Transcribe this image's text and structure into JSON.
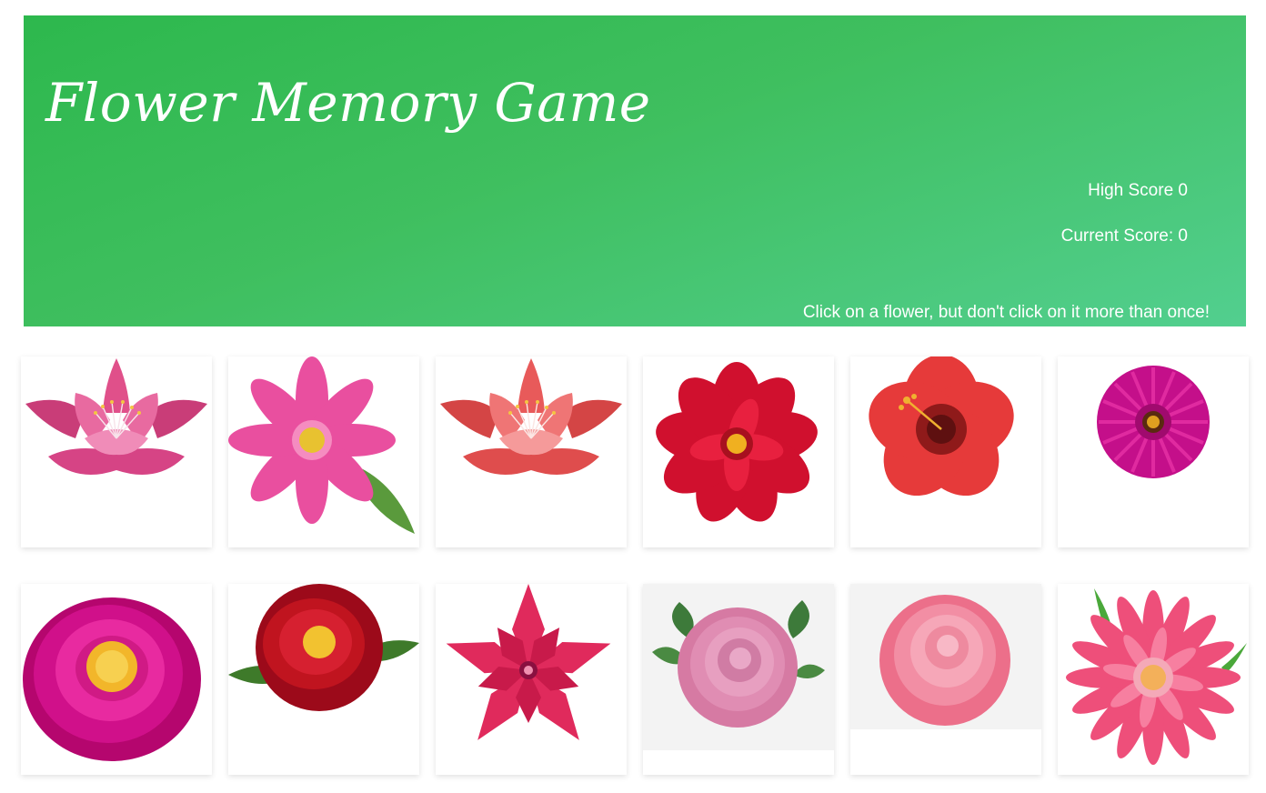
{
  "header": {
    "title": "Flower Memory Game",
    "high_score_label": "High Score 0",
    "current_score_label": "Current Score: 0",
    "instructions": "Click on a flower, but don't click on it more than once!"
  },
  "colors": {
    "header_gradient_start": "#2db84d",
    "header_gradient_end": "#52cf8f"
  },
  "cards": [
    {
      "name": "pink-lotus-flower-card"
    },
    {
      "name": "pink-cosmos-flower-card"
    },
    {
      "name": "coral-lotus-flower-card"
    },
    {
      "name": "red-dahlia-flower-card"
    },
    {
      "name": "red-hibiscus-flower-card"
    },
    {
      "name": "magenta-daisy-flower-card"
    },
    {
      "name": "magenta-peony-flower-card"
    },
    {
      "name": "red-camellia-flower-card"
    },
    {
      "name": "pink-star-flower-card"
    },
    {
      "name": "pink-rose-leaves-flower-card"
    },
    {
      "name": "light-pink-rose-flower-card"
    },
    {
      "name": "pink-gerbera-flower-card"
    }
  ]
}
